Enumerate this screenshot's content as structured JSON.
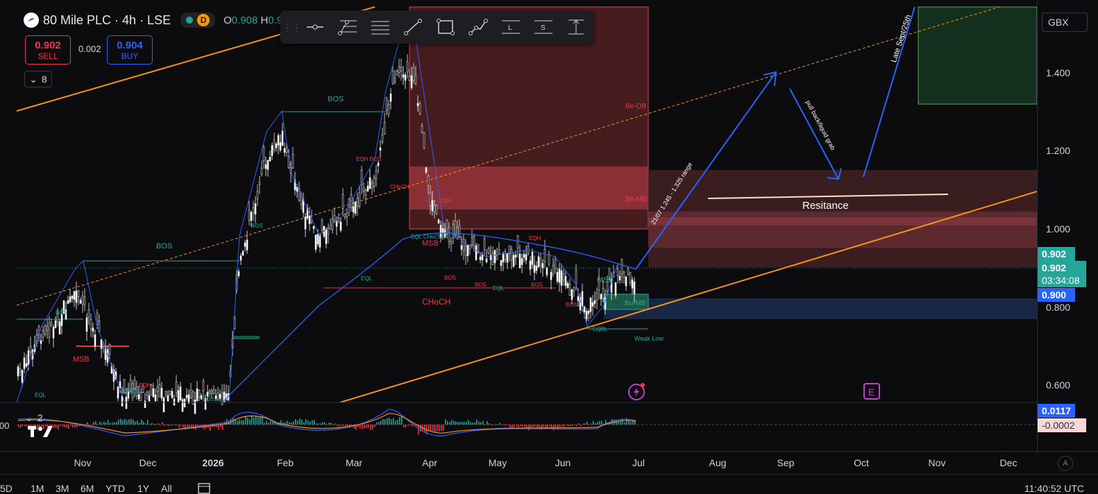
{
  "header": {
    "symbol_title": "80 Mile PLC · 4h · LSE",
    "delay_badge": "D",
    "ohlc_label": "O",
    "ohlc_value": "0.908",
    "ohlc_h_label": "H",
    "ohlc_h_value": "0.9"
  },
  "trade": {
    "sell_price": "0.902",
    "sell_label": "SELL",
    "spread": "0.002",
    "buy_price": "0.904",
    "buy_label": "BUY"
  },
  "indicators": {
    "main_count": "8",
    "sub_count": "2",
    "sub_axis_partial": "00"
  },
  "draw_toolbar": {
    "tools": [
      "horizontal-ray-icon",
      "fib-retracement-icon",
      "parallel-channel-icon",
      "trend-line-icon",
      "rectangle-icon",
      "path-icon",
      "long-position-icon",
      "short-position-icon",
      "measure-icon"
    ]
  },
  "price_axis": {
    "currency": "GBX",
    "labels": [
      "1.400",
      "1.200",
      "1.000",
      "0.800",
      "0.600"
    ],
    "tag_price_top": "0.902",
    "tag_price_mid": "0.902",
    "countdown": "03:34:08",
    "tag_low": "0.900",
    "tag_osc_blue": "0.0117",
    "tag_osc_pink": "-0.0002"
  },
  "time_axis": {
    "labels": [
      "Nov",
      "Dec",
      "2026",
      "Feb",
      "Mar",
      "Apr",
      "May",
      "Jun",
      "Jul",
      "Aug",
      "Sep",
      "Oct",
      "Nov",
      "Dec"
    ],
    "auto": "A"
  },
  "bottom_bar": {
    "ranges": [
      "5D",
      "1M",
      "3M",
      "6M",
      "YTD",
      "1Y",
      "All"
    ],
    "clock": "11:40:52 UTC"
  },
  "annotations": {
    "resistance": "Resitance",
    "range_note": "21/07 1.245 - 1.325 range",
    "pullback_note": "pull back/liquid grab",
    "late_sept": "Late Sept/25th",
    "be_ob": "Be-OB",
    "be_mb": "Be-MB",
    "bu_mb": "Bu-MB",
    "weak_low": "Weak Low",
    "choch": "CHoCH",
    "bos": "BOS",
    "msb": "MSB",
    "eql": "EQL",
    "eqh": "EQH",
    "eqh_bos": "EQH BOS",
    "choch_small": "CHoCH",
    "eql_choch": "EQL CHoCH",
    "eqbl": "EQBL"
  },
  "colors": {
    "bullish": "#26a69a",
    "bearish": "#f23645",
    "trendline": "#f7931a",
    "ma": "#2962ff",
    "bg": "#0c0c0e"
  }
}
